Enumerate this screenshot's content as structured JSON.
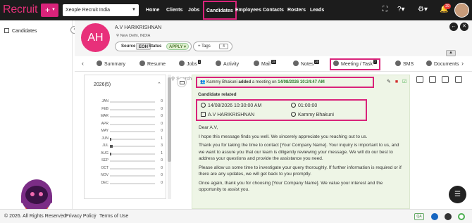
{
  "topbar": {
    "logo": "Recruit",
    "plus": "+",
    "org_select": "Xeople Recruit India",
    "nav": [
      "Home",
      "Clients",
      "Jobs",
      "Candidates",
      "Employees",
      "Contacts",
      "Rosters",
      "Leads"
    ],
    "active_nav": "Candidates",
    "notification_count": "29",
    "accent": "#d9237a"
  },
  "sidebar": {
    "item_label": "Candidates"
  },
  "candidate": {
    "initials": "AH",
    "name": "A.V HARIKRISHNAN",
    "location": "New Delhi, INDIA",
    "source_label": "Source",
    "source_value": "EOH",
    "status_label": "Status",
    "status_value": "APPLY",
    "tags_label": "+ Tags",
    "tags_count": "4"
  },
  "tabs": [
    {
      "label": "Summary",
      "count": ""
    },
    {
      "label": "Resume",
      "count": ""
    },
    {
      "label": "Jobs",
      "count": "1"
    },
    {
      "label": "Activity",
      "count": ""
    },
    {
      "label": "Mail",
      "count": "15"
    },
    {
      "label": "Notes",
      "count": "20"
    },
    {
      "label": "Meeting / Task",
      "count": "7"
    },
    {
      "label": "SMS",
      "count": ""
    },
    {
      "label": "Documents",
      "count": ""
    }
  ],
  "search": {
    "placeholder": "Search"
  },
  "timeline": {
    "year_label": "2026(5)",
    "months": [
      {
        "name": "JAN",
        "count": 0
      },
      {
        "name": "FEB",
        "count": 0
      },
      {
        "name": "MAR",
        "count": 0
      },
      {
        "name": "APR",
        "count": 0
      },
      {
        "name": "MAY",
        "count": 0
      },
      {
        "name": "JUN",
        "count": 1
      },
      {
        "name": "JUL",
        "count": 3
      },
      {
        "name": "AUG",
        "count": 1
      },
      {
        "name": "SEP",
        "count": 0
      },
      {
        "name": "OCT",
        "count": 0
      },
      {
        "name": "NOV",
        "count": 0
      },
      {
        "name": "DEC",
        "count": 0
      }
    ]
  },
  "event": {
    "actor": "Kammy Bhakuni",
    "action": "added",
    "object": "a meeting on",
    "datetime": "14/08/2026 10:24:47 AM",
    "category": "Candidate related",
    "date_time": "14/08/2026 10:30:00 AM",
    "duration": "01:00:00",
    "candidate": "A.V HARIKRISHNAN",
    "owner": "Kammy Bhakuni",
    "body": [
      "Dear A.V,",
      "I hope this message finds you well. We sincerely appreciate you reaching out to us.",
      "Thank you for taking the time to contact [Your Company Name]. Your inquiry is important to us, and we want to assure you that our team is diligently reviewing your message. We will do our best to address your questions and provide the assistance you need.",
      "Please allow us some time to investigate your query thoroughly. If further information is required or if there are any updates, we will get back to you promptly.",
      "Once again, thank you for choosing [Your Company Name]. We value your interest and the opportunity to assist you."
    ]
  },
  "footer": {
    "copyright": "© 2026. All Rights Reserved",
    "privacy": "Privacy Policy",
    "terms": "Terms of Use",
    "qa": "QA"
  }
}
